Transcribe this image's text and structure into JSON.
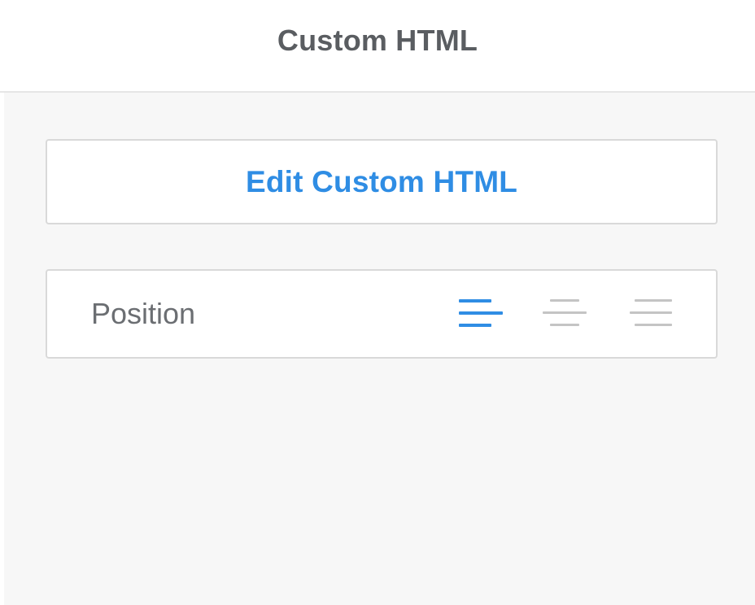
{
  "header": {
    "title": "Custom HTML"
  },
  "actions": {
    "edit_label": "Edit Custom HTML"
  },
  "position": {
    "label": "Position",
    "options": [
      {
        "name": "align-left-icon",
        "selected": true
      },
      {
        "name": "align-center-icon",
        "selected": false
      },
      {
        "name": "align-right-icon",
        "selected": false
      }
    ]
  },
  "colors": {
    "accent": "#2f8de4",
    "inactive_icon": "#c4c4c4",
    "title_text": "#5a5d61",
    "label_text": "#6b6e72",
    "panel_bg": "#f7f7f7",
    "border": "#d9d9d9"
  }
}
